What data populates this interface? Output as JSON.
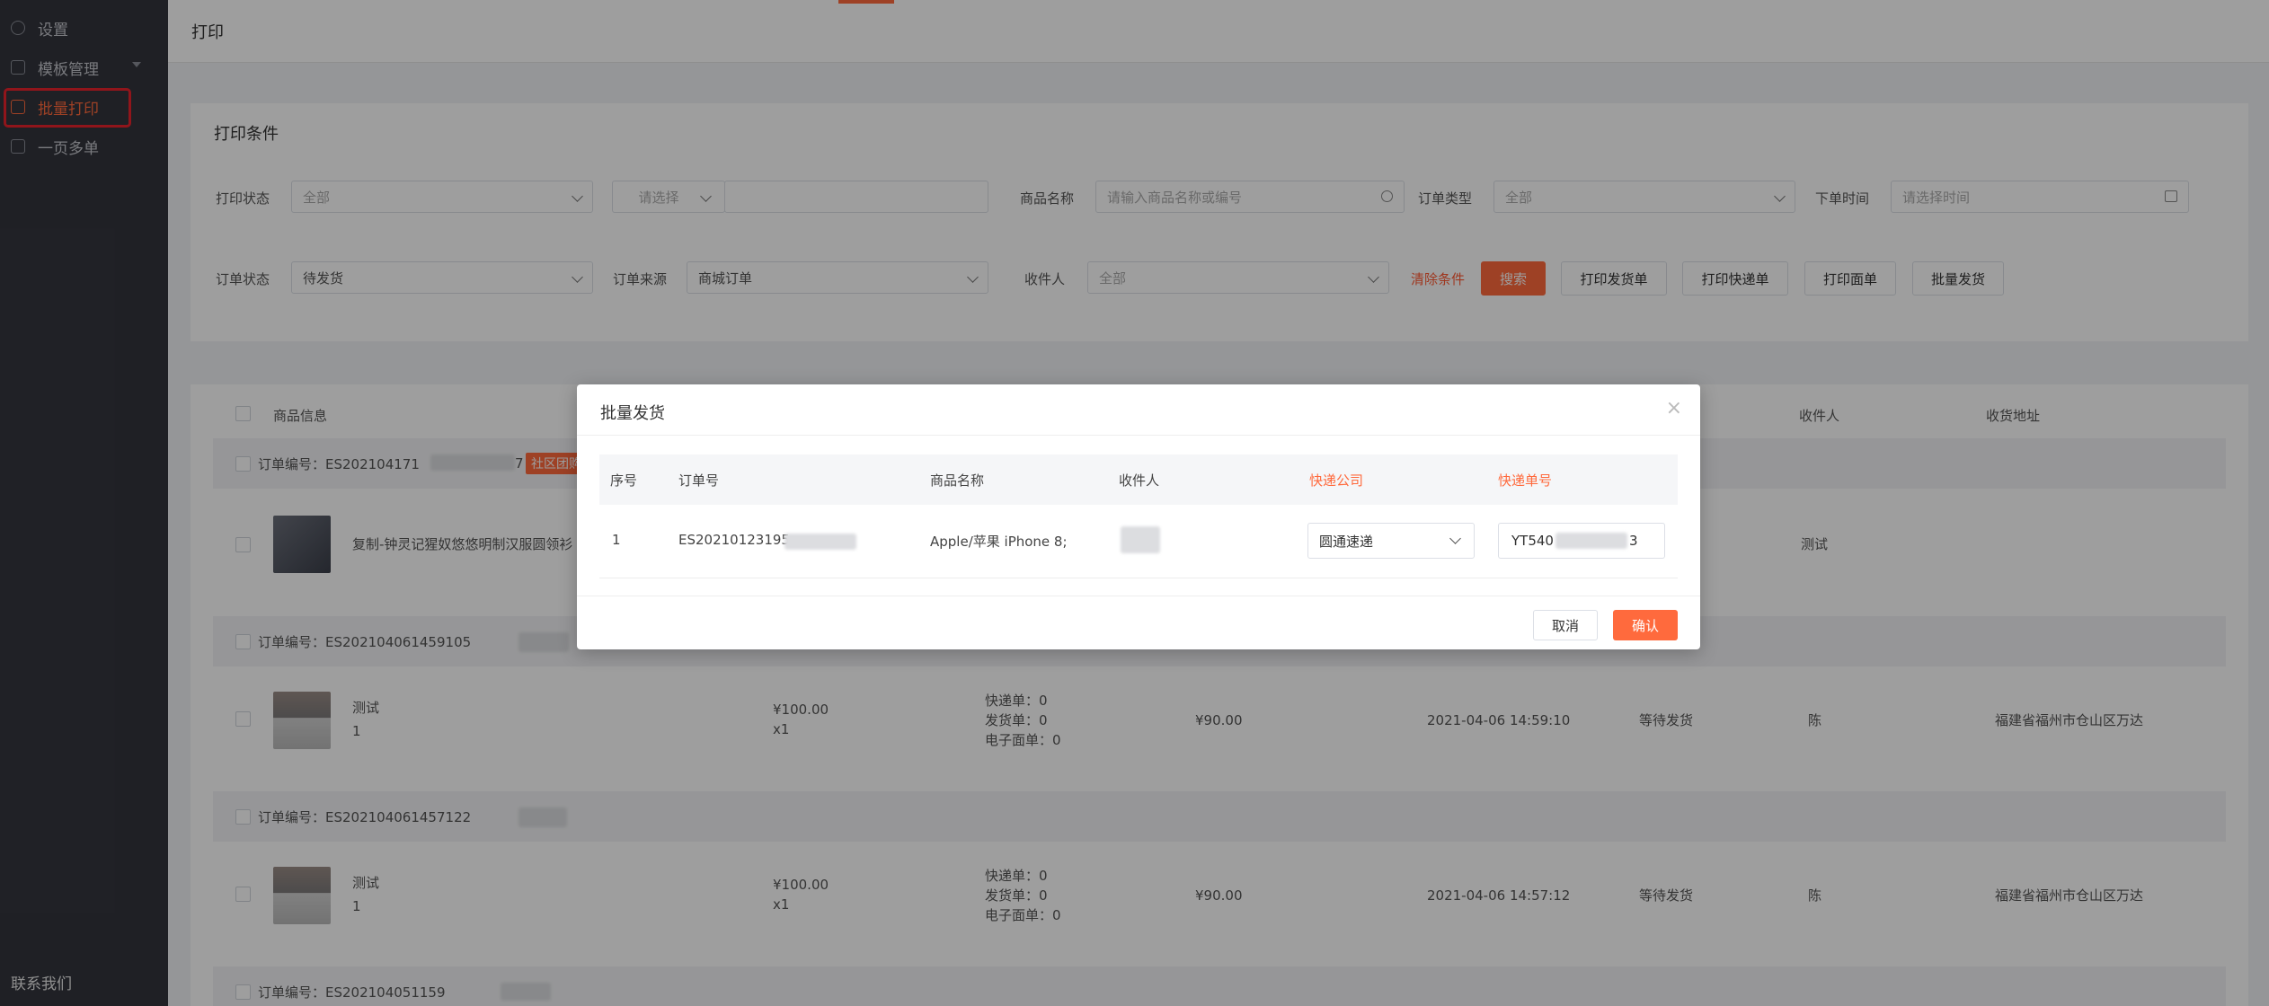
{
  "sidebar": {
    "items": [
      {
        "label": "设置",
        "icon": "gear-icon"
      },
      {
        "label": "模板管理",
        "icon": "template-icon"
      },
      {
        "label": "批量打印",
        "icon": "print-icon"
      },
      {
        "label": "一页多单",
        "icon": "document-icon"
      }
    ],
    "contact": "联系我们"
  },
  "header": {
    "title": "打印"
  },
  "conditions": {
    "title": "打印条件",
    "print_status_label": "打印状态",
    "print_status_value": "全部",
    "select_placeholder": "请选择",
    "product_name_label": "商品名称",
    "product_name_placeholder": "请输入商品名称或编号",
    "order_type_label": "订单类型",
    "order_type_value": "全部",
    "order_time_label": "下单时间",
    "order_time_placeholder": "请选择时间",
    "order_status_label": "订单状态",
    "order_status_value": "待发货",
    "order_source_label": "订单来源",
    "order_source_value": "商城订单",
    "receiver_label": "收件人",
    "receiver_value": "全部",
    "clear_label": "清除条件",
    "search_label": "搜索",
    "btn_print_delivery": "打印发货单",
    "btn_print_express": "打印快递单",
    "btn_print_sheet": "打印面单",
    "btn_batch_ship": "批量发货"
  },
  "list": {
    "columns": {
      "product": "商品信息",
      "receiver": "收件人",
      "address": "收货地址"
    },
    "orders": [
      {
        "no": "订单编号：ES202104171",
        "suffix": "7",
        "tag": "社区团购",
        "product": "复制-钟灵记猩奴悠悠明制汉服圆领衫",
        "receiver": "测试"
      },
      {
        "no": "订单编号：ES202104061459105",
        "product": "测试",
        "qty": "1",
        "price": "¥100.00",
        "count": "x1",
        "express": "快递单：0",
        "delivery": "发货单：0",
        "esheet": "电子面单：0",
        "paid": "¥90.00",
        "time": "2021-04-06 14:59:10",
        "status": "等待发货",
        "receiver": "陈",
        "address": "福建省福州市仓山区万达"
      },
      {
        "no": "订单编号：ES202104061457122",
        "product": "测试",
        "qty": "1",
        "price": "¥100.00",
        "count": "x1",
        "express": "快递单：0",
        "delivery": "发货单：0",
        "esheet": "电子面单：0",
        "paid": "¥90.00",
        "time": "2021-04-06 14:57:12",
        "status": "等待发货",
        "receiver": "陈",
        "address": "福建省福州市仓山区万达"
      },
      {
        "no": "订单编号：ES202104051159"
      }
    ]
  },
  "modal": {
    "title": "批量发货",
    "columns": {
      "index": "序号",
      "order_no": "订单号",
      "product": "商品名称",
      "receiver": "收件人",
      "company": "快递公司",
      "tracking": "快递单号"
    },
    "row": {
      "index": "1",
      "order_no": "ES20210123195",
      "product": "Apple/苹果 iPhone 8;",
      "company": "圆通速递",
      "tracking_prefix": "YT540",
      "tracking_suffix": "3"
    },
    "cancel_label": "取消",
    "confirm_label": "确认"
  },
  "colors": {
    "accent": "#ff6a3d",
    "sidebar": "#33353d",
    "highlight": "#e8232c"
  }
}
